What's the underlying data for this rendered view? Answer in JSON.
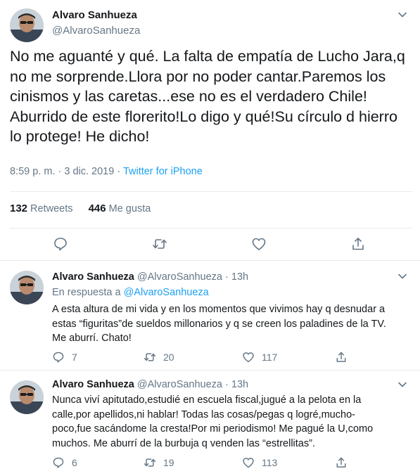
{
  "main_tweet": {
    "name": "Alvaro Sanhueza",
    "handle": "@AlvaroSanhueza",
    "text": "No me aguanté y qué. La falta de empatía de Lucho Jara,q\nno me sorprende.Llora por no poder cantar.Paremos los\ncinismos y las caretas...ese no es el verdadero Chile!\nAburrido de este florerito!Lo digo y qué!Su círculo d hierro\nlo protege! He dicho!",
    "time": "8:59 p. m. · 3 dic. 2019 · ",
    "source": "Twitter for iPhone",
    "retweets_count": "132",
    "retweets_label": " Retweets",
    "likes_count": "446",
    "likes_label": " Me gusta"
  },
  "replies": [
    {
      "name": "Alvaro Sanhueza",
      "handle": " @AlvaroSanhueza · 13h",
      "in_reply_prefix": "En respuesta a ",
      "in_reply_handle": "@AlvaroSanhueza",
      "text": "A esta altura de mi vida y en los momentos que vivimos hay q desnudar a\nestas “figuritas”de sueldos millonarios y q se creen los paladines de la TV.\nMe aburrí. Chato!",
      "replies_count": "7",
      "retweets_count": "20",
      "likes_count": "117"
    },
    {
      "name": "Alvaro Sanhueza",
      "handle": " @AlvaroSanhueza · 13h",
      "text": "Nunca viví apitutado,estudié en escuela fiscal,jugué a la pelota en la\ncalle,por apellidos,ni hablar! Todas las cosas/pegas q logré,mucho-\npoco,fue sacándome la cresta!Por mi periodismo! Me pagué la U,como\nmuchos. Me aburrí de la burbuja q venden las “estrellitas”.",
      "replies_count": "6",
      "retweets_count": "19",
      "likes_count": "113"
    }
  ],
  "colors": {
    "accent": "#1da1f2",
    "secondary_text": "#657786",
    "border": "#e6ecf0"
  },
  "icons": [
    "chevron-down-icon",
    "reply-icon",
    "retweet-icon",
    "like-icon",
    "share-icon"
  ]
}
